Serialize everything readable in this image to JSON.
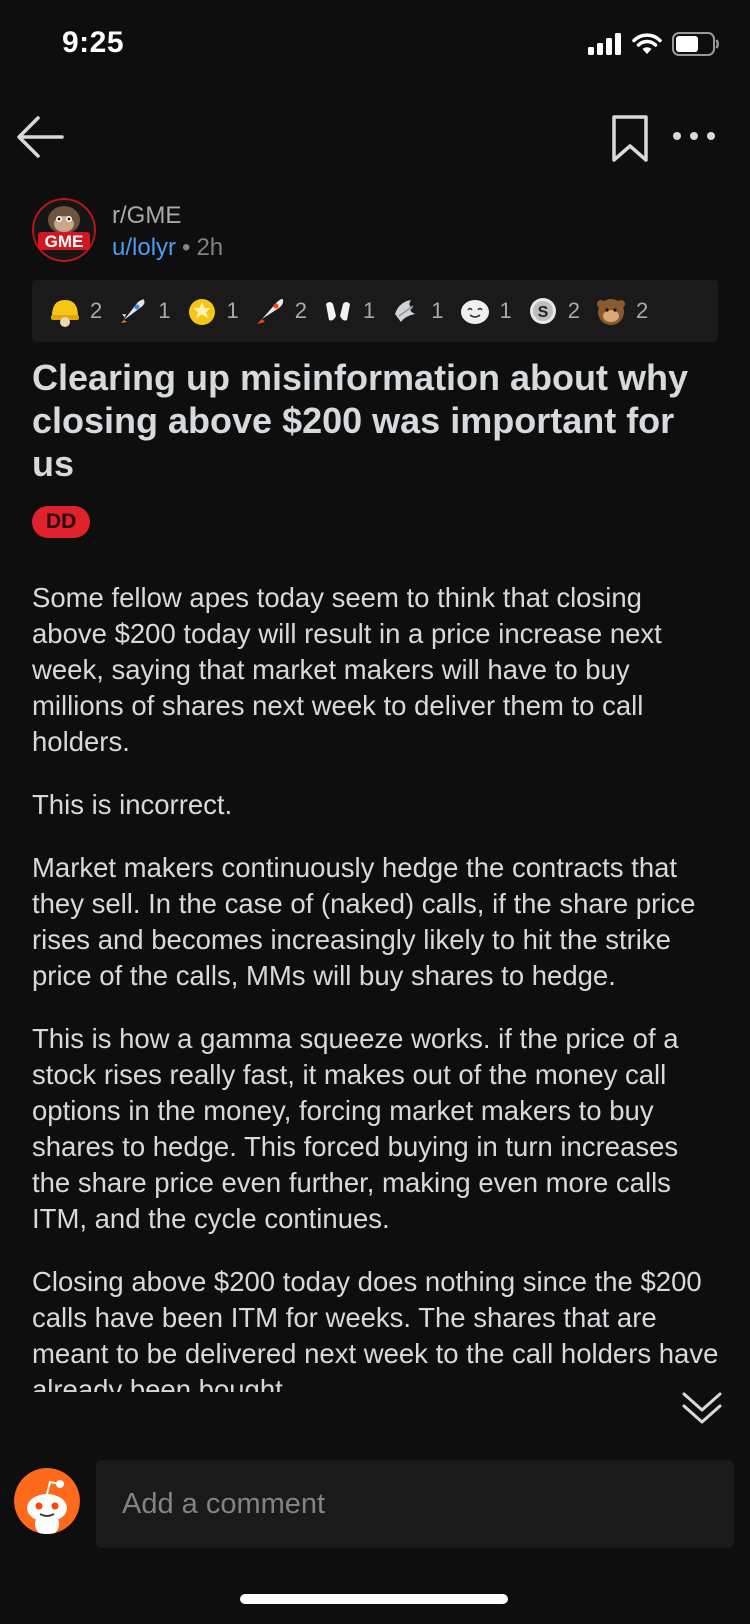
{
  "status_bar": {
    "time": "9:25"
  },
  "post": {
    "subreddit": "r/GME",
    "subreddit_avatar_text": "GME",
    "author": "u/lolyr",
    "separator": "•",
    "age": "2h",
    "awards": [
      {
        "icon": "helmet-award-icon",
        "count": "2"
      },
      {
        "icon": "rocket-award-icon",
        "count": "1"
      },
      {
        "icon": "star-face-award-icon",
        "count": "1"
      },
      {
        "icon": "rocket-like-award-icon",
        "count": "2"
      },
      {
        "icon": "hands-award-icon",
        "count": "1"
      },
      {
        "icon": "silver-wings-award-icon",
        "count": "1"
      },
      {
        "icon": "wholesome-award-icon",
        "count": "1"
      },
      {
        "icon": "coin-s-award-icon",
        "count": "2"
      },
      {
        "icon": "ape-award-icon",
        "count": "2"
      }
    ],
    "title": "Clearing up misinformation about why closing above $200 was important for us",
    "flair": "DD",
    "body": [
      "Some fellow apes today seem to think that closing above $200 today will result in a price increase next week, saying that market makers will have to buy millions of shares next week to deliver them to call holders.",
      "This is incorrect.",
      "Market makers continuously hedge the contracts that they sell. In the case of (naked) calls, if the share price rises and becomes increasingly likely to hit the strike price of the calls, MMs will buy shares to hedge.",
      "This is how a gamma squeeze works. if the price of a stock rises really fast, it makes out of the money call options in the money, forcing market makers to buy shares to hedge. This forced buying in turn increases the share price even further, making even more calls ITM, and the cycle continues.",
      "Closing above $200 today does nothing since the $200 calls have been ITM for weeks. The shares that are meant to be delivered next week to the call holders have already been bought."
    ]
  },
  "comment": {
    "placeholder": "Add a comment"
  },
  "colors": {
    "background": "#0e0e0f",
    "username": "#4d9cf0",
    "flair_bg": "#e0222c",
    "card": "#1a1a1b"
  }
}
